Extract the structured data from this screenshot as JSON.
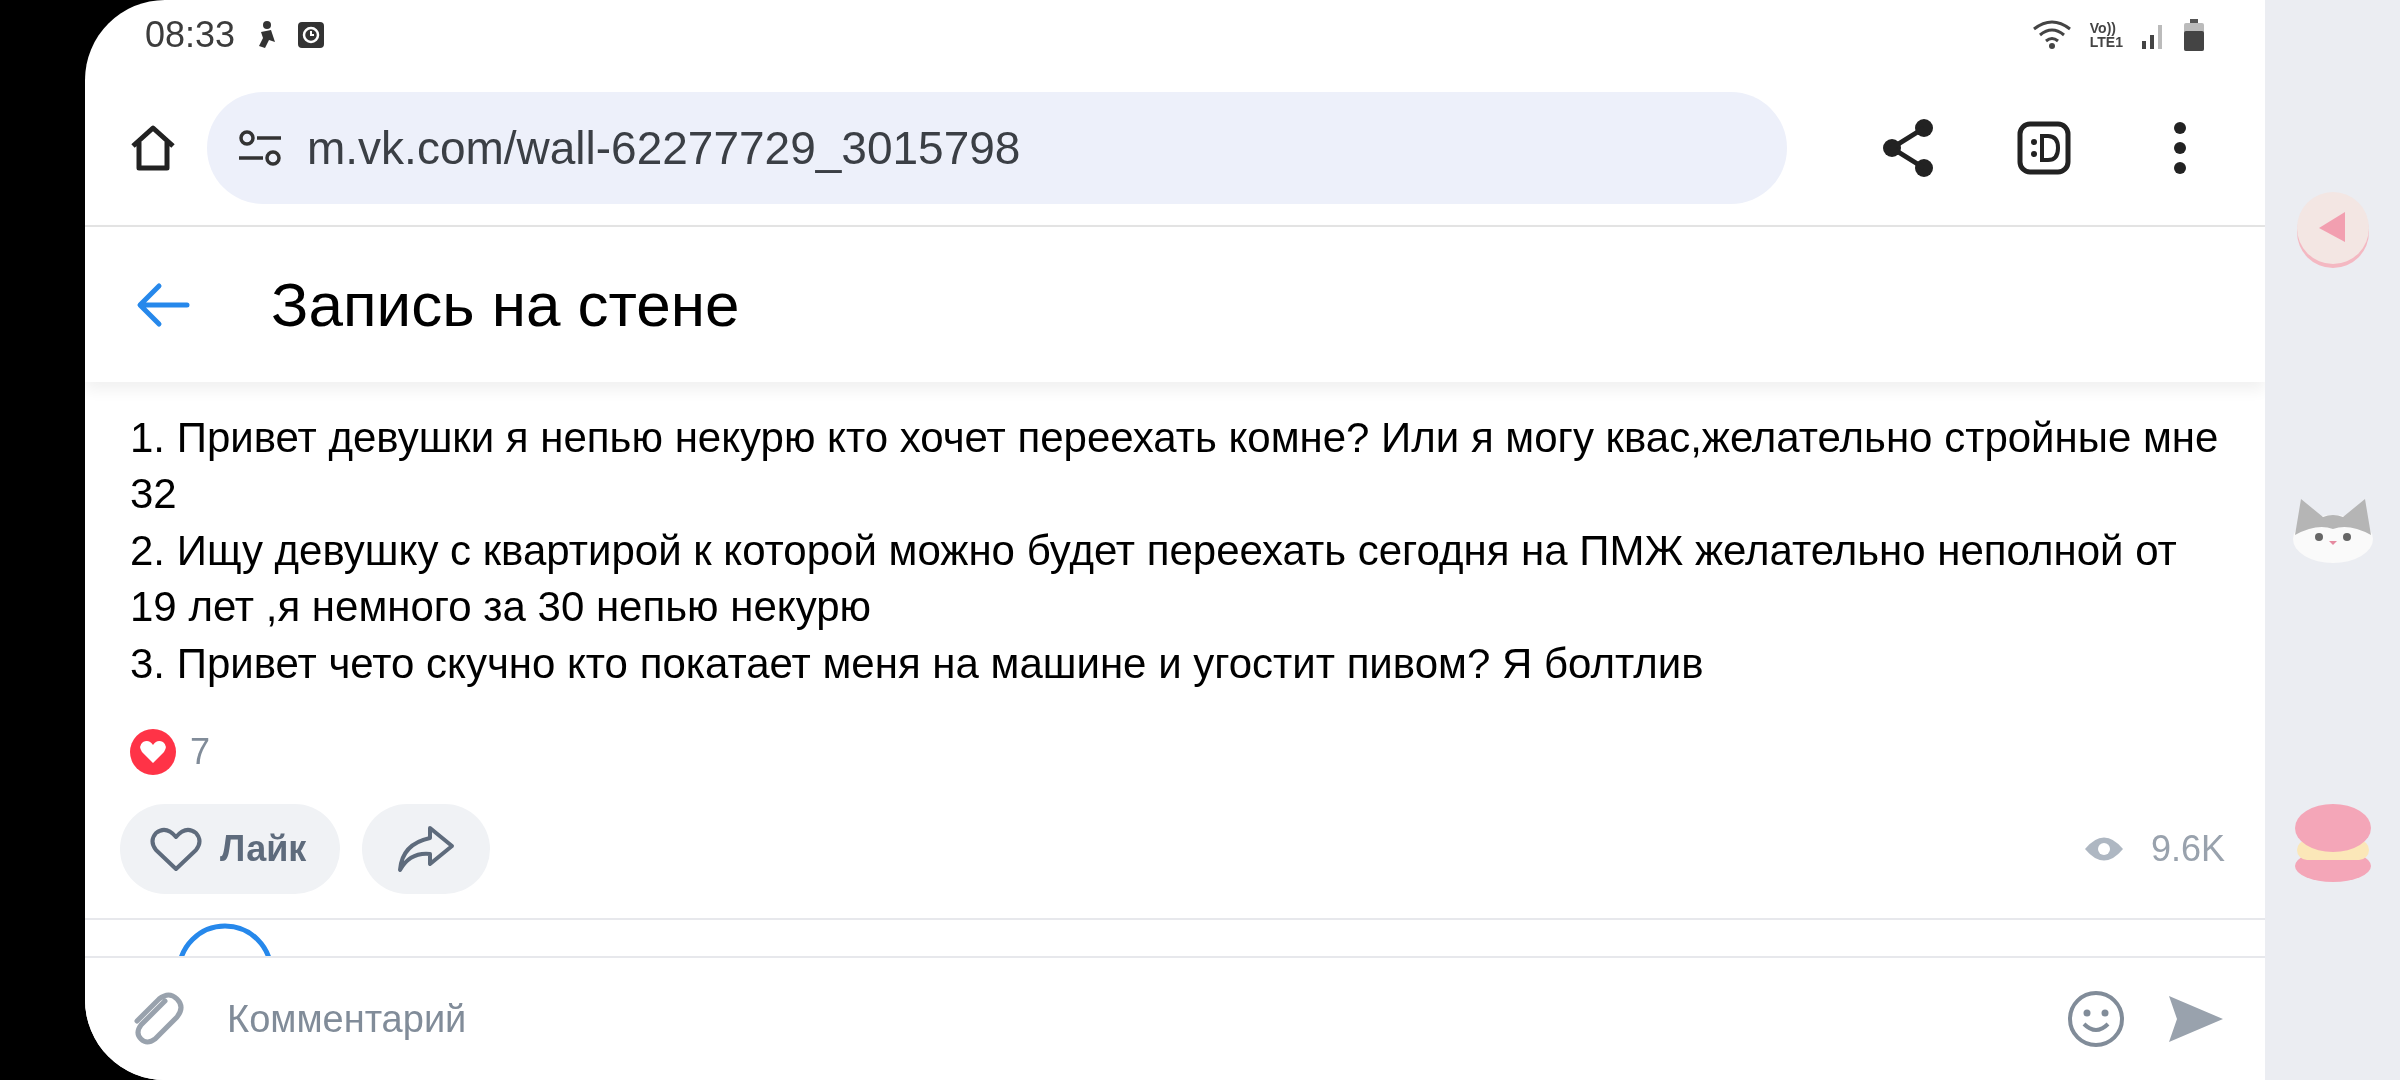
{
  "status_bar": {
    "time": "08:33",
    "network": [
      "Vo))",
      "LTE1"
    ]
  },
  "browser": {
    "url": "m.vk.com/wall-62277729_3015798"
  },
  "page": {
    "title": "Запись на стене"
  },
  "post": {
    "paragraphs": [
      "1. Привет девушки я непью некурю кто хочет переехать комне? Или я могу квас,желательно стройные мне 32",
      "2. Ищу девушку с квартирой к которой можно будет переехать сегодня на ПМЖ желательно неполной от 19 лет ,я немного за 30 непью некурю",
      "3. Привет чето скучно кто покатает меня на машине и угостит пивом? Я болтлив"
    ],
    "reactions": "7",
    "like_button": {
      "label": "Лайк",
      "selected": false
    },
    "views": "9.6K"
  },
  "comment": {
    "placeholder": "Комментарий"
  }
}
